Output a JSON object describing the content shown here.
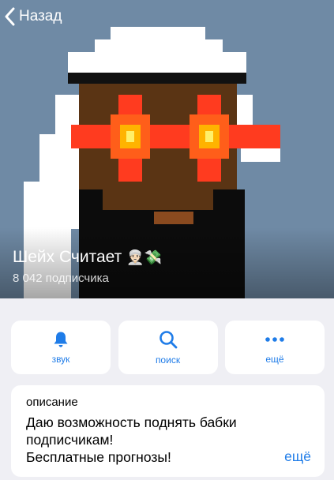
{
  "nav": {
    "back_label": "Назад"
  },
  "channel": {
    "title": "Шейх Считает",
    "title_emojis": "👳🏻💸",
    "subscribers": "8 042 подписчика"
  },
  "actions": [
    {
      "label": "звук",
      "icon": "bell-icon"
    },
    {
      "label": "поиск",
      "icon": "search-icon"
    },
    {
      "label": "ещё",
      "icon": "more-icon"
    }
  ],
  "description": {
    "heading": "описание",
    "lines": [
      "Даю возможность поднять бабки",
      "подписчикам!",
      "Бесплатные прогнозы!"
    ],
    "more_label": "ещё"
  },
  "colors": {
    "accent": "#1f7ce8",
    "header_bg": "#6f8aa5",
    "page_bg": "#efeff4"
  }
}
